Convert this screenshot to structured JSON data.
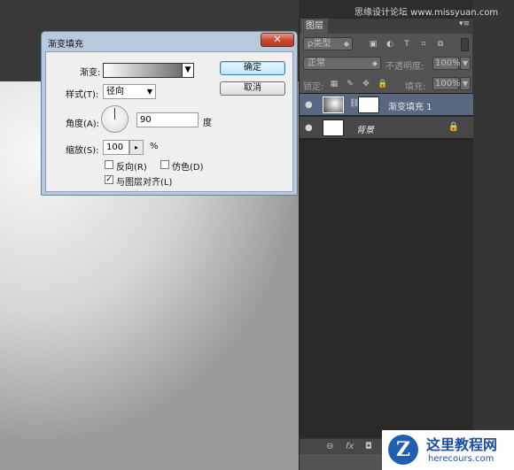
{
  "watermark": "思缘设计论坛 www.missyuan.com",
  "dialog": {
    "title": "渐变填充",
    "close_glyph": "✕",
    "gradient_label": "渐变:",
    "gradient_drop": "▼",
    "style_label": "样式(T):",
    "style_value": "径向",
    "angle_label": "角度(A):",
    "angle_value": "90",
    "angle_unit": "度",
    "scale_label": "缩放(S):",
    "scale_value": "100",
    "scale_unit": "%",
    "reverse_label": "反向(R)",
    "reverse_checked": false,
    "dither_label": "仿色(D)",
    "dither_checked": false,
    "align_label": "与图层对齐(L)",
    "align_checked": true,
    "check_mark": "✓",
    "ok_label": "确定",
    "cancel_label": "取消"
  },
  "panel": {
    "tab_label": "图层",
    "menu_glyph": "▾≡",
    "filter_kind": "ρ类型",
    "filter_icons": [
      "image-icon",
      "adjustment-icon",
      "type-icon",
      "shape-icon",
      "smart-object-icon"
    ],
    "filter_glyphs": [
      "▣",
      "◐",
      "T",
      "⌗",
      "⧉"
    ],
    "blend_mode": "正常",
    "opacity_label": "不透明度:",
    "opacity_value": "100%",
    "lock_label": "锁定:",
    "lock_glyphs": [
      "▦",
      "✎",
      "✥",
      "🔒"
    ],
    "fill_label": "填充:",
    "fill_value": "100%",
    "layers": [
      {
        "name": "渐变填充 1",
        "selected": true
      },
      {
        "name": "背景",
        "selected": false,
        "locked": true
      }
    ],
    "bottom_glyphs": [
      "⊖",
      "fx",
      "◘"
    ]
  },
  "logo": {
    "mark": "Z",
    "name": "这里教程网",
    "url": "herecours.com"
  }
}
